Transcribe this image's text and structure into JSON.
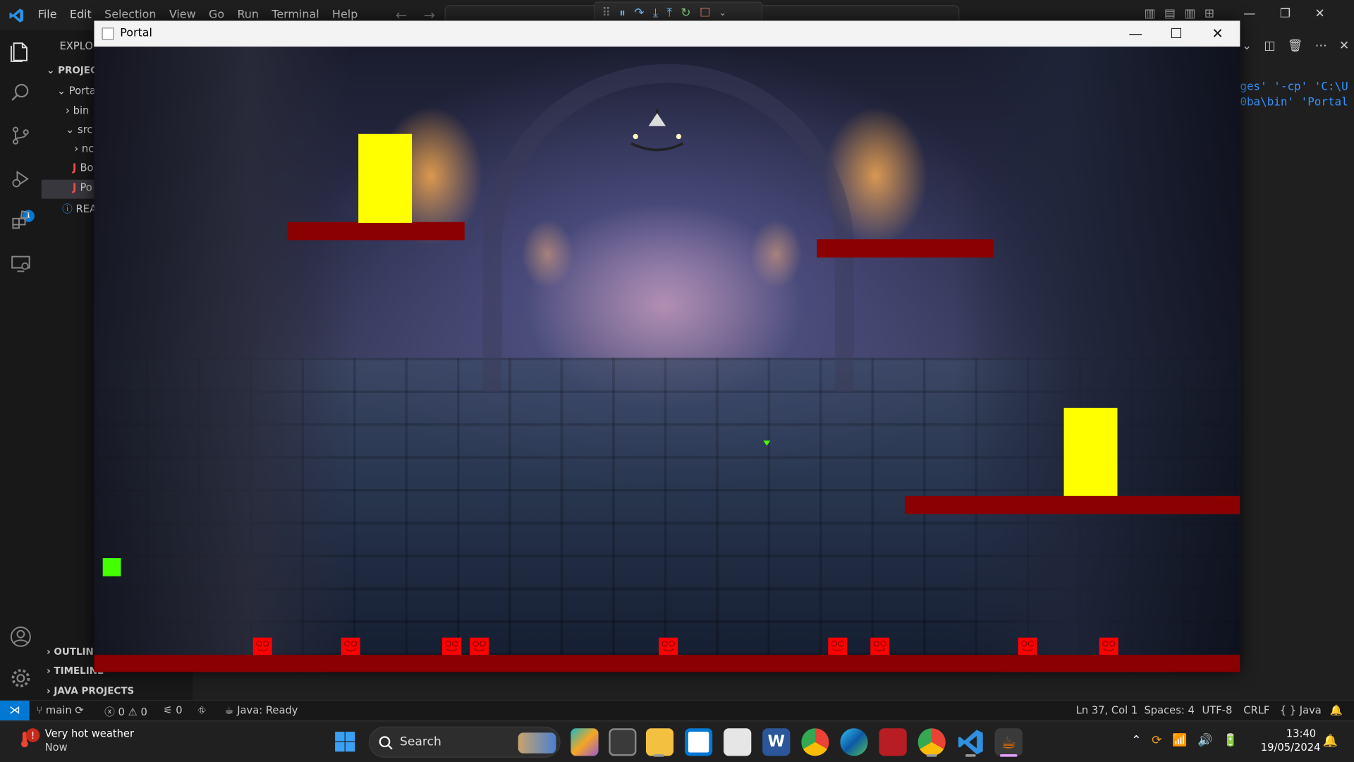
{
  "vscode": {
    "menu": [
      "File",
      "Edit",
      "Selection",
      "View",
      "Go",
      "Run",
      "Terminal",
      "Help"
    ],
    "sidebar": {
      "explorer_title": "EXPLOR",
      "project_title": "PROJEC",
      "tree": [
        {
          "label": "Porta",
          "depth": 1,
          "chevron": "v"
        },
        {
          "label": "bin",
          "depth": 2,
          "chevron": ">"
        },
        {
          "label": "src",
          "depth": 2,
          "chevron": "v"
        },
        {
          "label": "nc",
          "depth": 3,
          "chevron": ">"
        },
        {
          "label": "Bo",
          "depth": 3,
          "icon": "J"
        },
        {
          "label": "Po",
          "depth": 3,
          "icon": "J"
        },
        {
          "label": "REA",
          "depth": 2,
          "icon": "i"
        }
      ],
      "sections": [
        "OUTLIN",
        "TIMELINE",
        "JAVA PROJECTS"
      ]
    },
    "debug_badge": "1",
    "terminal_lines": [
      "ges' '-cp' 'C:\\U",
      "0ba\\bin' 'Portal"
    ],
    "statusbar": {
      "branch": "main",
      "errors": "0",
      "warnings": "0",
      "ports": "0",
      "java_status": "Java: Ready",
      "position": "Ln 37, Col 1",
      "spaces": "Spaces: 4",
      "encoding": "UTF-8",
      "eol": "CRLF",
      "language": "{ } Java"
    }
  },
  "game_window": {
    "title": "Portal",
    "minimize": "—",
    "maximize": "☐",
    "close": "✕"
  },
  "colors": {
    "platform": "#8b0000",
    "crate": "#ffff00",
    "spike": "#ff0000",
    "player": "#44ff00"
  },
  "taskbar": {
    "weather_title": "Very hot weather",
    "weather_sub": "Now",
    "search_label": "Search",
    "time": "13:40",
    "date": "19/05/2024"
  }
}
